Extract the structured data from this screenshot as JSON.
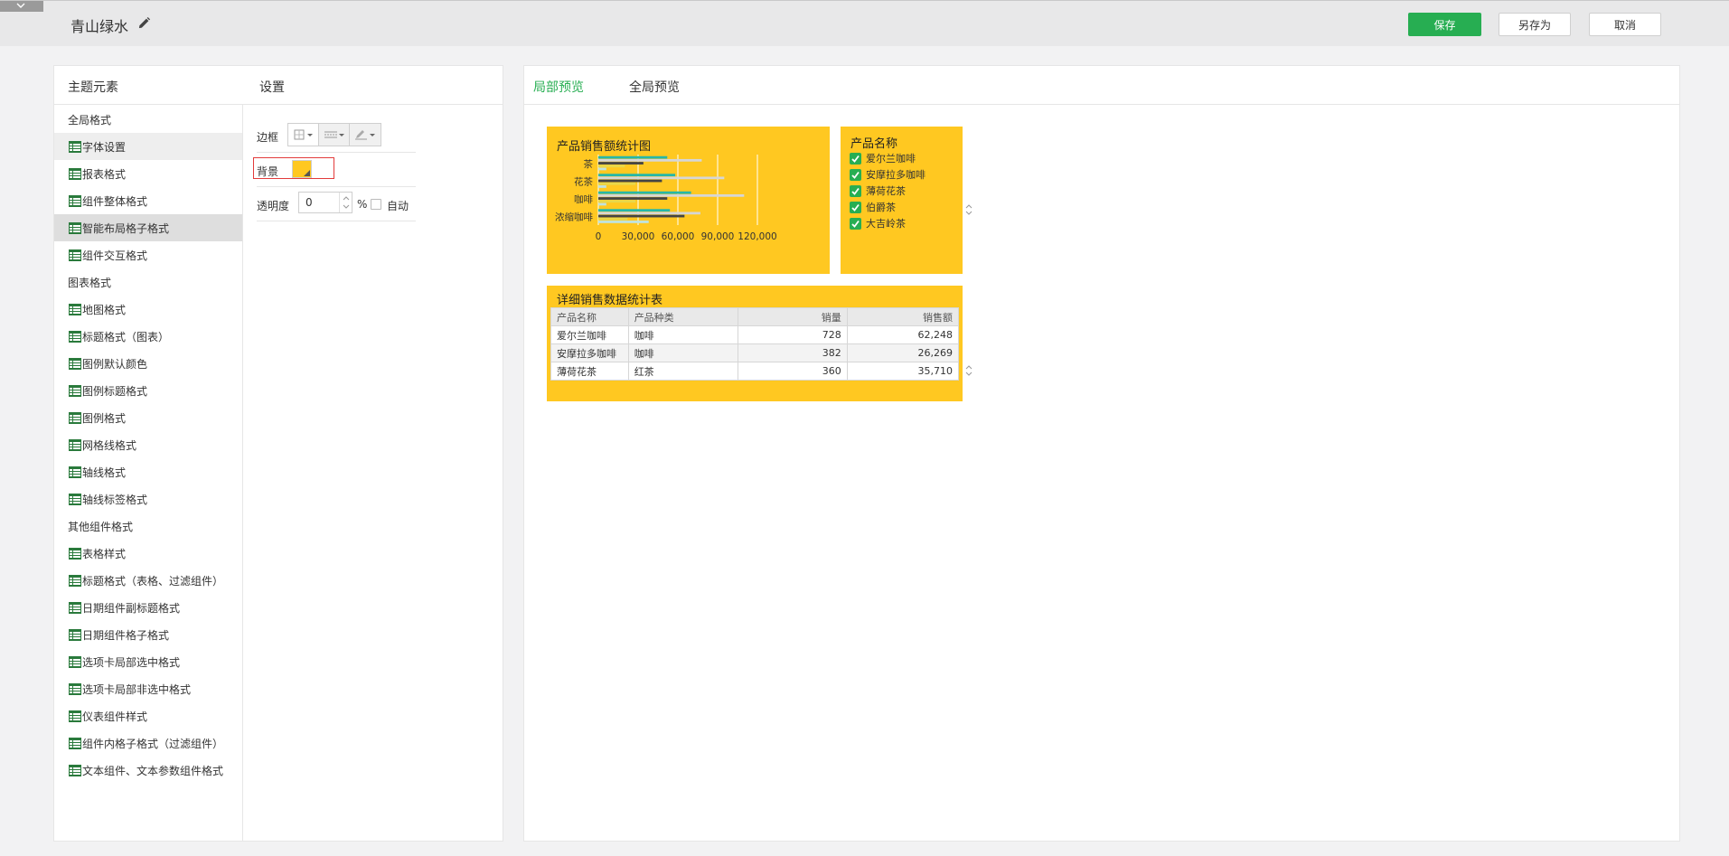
{
  "header": {
    "title": "青山绿水",
    "save_label": "保存",
    "save_as_label": "另存为",
    "cancel_label": "取消"
  },
  "colors": {
    "accent": "#27ae52",
    "card_bg": "#ffc821",
    "highlight_border": "#e23b3b"
  },
  "left_panel": {
    "elements_header": "主题元素",
    "settings_header": "设置",
    "items": [
      {
        "label": "全局格式",
        "type": "group"
      },
      {
        "label": "字体设置",
        "type": "child",
        "state": "selected-light"
      },
      {
        "label": "报表格式",
        "type": "child"
      },
      {
        "label": "组件整体格式",
        "type": "child"
      },
      {
        "label": "智能布局格子格式",
        "type": "child",
        "state": "selected"
      },
      {
        "label": "组件交互格式",
        "type": "child"
      },
      {
        "label": "图表格式",
        "type": "group"
      },
      {
        "label": "地图格式",
        "type": "child"
      },
      {
        "label": "标题格式（图表）",
        "type": "child"
      },
      {
        "label": "图例默认颜色",
        "type": "child"
      },
      {
        "label": "图例标题格式",
        "type": "child"
      },
      {
        "label": "图例格式",
        "type": "child"
      },
      {
        "label": "网格线格式",
        "type": "child"
      },
      {
        "label": "轴线格式",
        "type": "child"
      },
      {
        "label": "轴线标签格式",
        "type": "child"
      },
      {
        "label": "其他组件格式",
        "type": "group"
      },
      {
        "label": "表格样式",
        "type": "child"
      },
      {
        "label": "标题格式（表格、过滤组件）",
        "type": "child"
      },
      {
        "label": "日期组件副标题格式",
        "type": "child"
      },
      {
        "label": "日期组件格子格式",
        "type": "child"
      },
      {
        "label": "选项卡局部选中格式",
        "type": "child"
      },
      {
        "label": "选项卡局部非选中格式",
        "type": "child"
      },
      {
        "label": "仪表组件样式",
        "type": "child"
      },
      {
        "label": "组件内格子格式（过滤组件）",
        "type": "child"
      },
      {
        "label": "文本组件、文本参数组件格式",
        "type": "child"
      }
    ]
  },
  "settings": {
    "border_label": "边框",
    "background_label": "背景",
    "background_color": "#ffc821",
    "opacity_label": "透明度",
    "opacity_value": "0",
    "percent_sign": "%",
    "auto_label": "自动",
    "auto_checked": false
  },
  "preview": {
    "tabs": [
      {
        "label": "局部预览",
        "active": true
      },
      {
        "label": "全局预览",
        "active": false
      }
    ],
    "filter": {
      "title": "产品名称",
      "options": [
        {
          "label": "爱尔兰咖啡",
          "checked": true
        },
        {
          "label": "安摩拉多咖啡",
          "checked": true
        },
        {
          "label": "薄荷花茶",
          "checked": true
        },
        {
          "label": "伯爵茶",
          "checked": true
        },
        {
          "label": "大吉岭茶",
          "checked": true
        }
      ]
    },
    "table": {
      "title": "详细销售数据统计表",
      "columns": [
        "产品名称",
        "产品种类",
        "销量",
        "销售额"
      ],
      "rows": [
        [
          "爱尔兰咖啡",
          "咖啡",
          "728",
          "62,248"
        ],
        [
          "安摩拉多咖啡",
          "咖啡",
          "382",
          "26,269"
        ],
        [
          "薄荷花茶",
          "红茶",
          "360",
          "35,710"
        ]
      ]
    }
  },
  "chart_data": {
    "type": "bar",
    "orientation": "horizontal",
    "title": "产品销售额统计图",
    "categories": [
      "茶",
      "花茶",
      "咖啡",
      "浓缩咖啡"
    ],
    "xlim": [
      0,
      120000
    ],
    "xticks": [
      0,
      30000,
      60000,
      90000,
      120000
    ],
    "xtick_labels": [
      "0",
      "30,000",
      "60,000",
      "90,000",
      "120,000"
    ],
    "grid": true,
    "series": [
      {
        "color": "#26b7a8",
        "values": [
          52000,
          58000,
          70000,
          54000
        ]
      },
      {
        "color": "#d6d6d6",
        "values": [
          78000,
          95000,
          110000,
          77000
        ]
      },
      {
        "color": "#444444",
        "values": [
          34000,
          48000,
          52000,
          65000
        ]
      },
      {
        "color": "#e8d84a",
        "values": [
          20000,
          28000,
          28000,
          22000
        ]
      },
      {
        "color": "#bfe3df",
        "values": [
          6000,
          6000,
          6000,
          38000
        ]
      }
    ]
  }
}
